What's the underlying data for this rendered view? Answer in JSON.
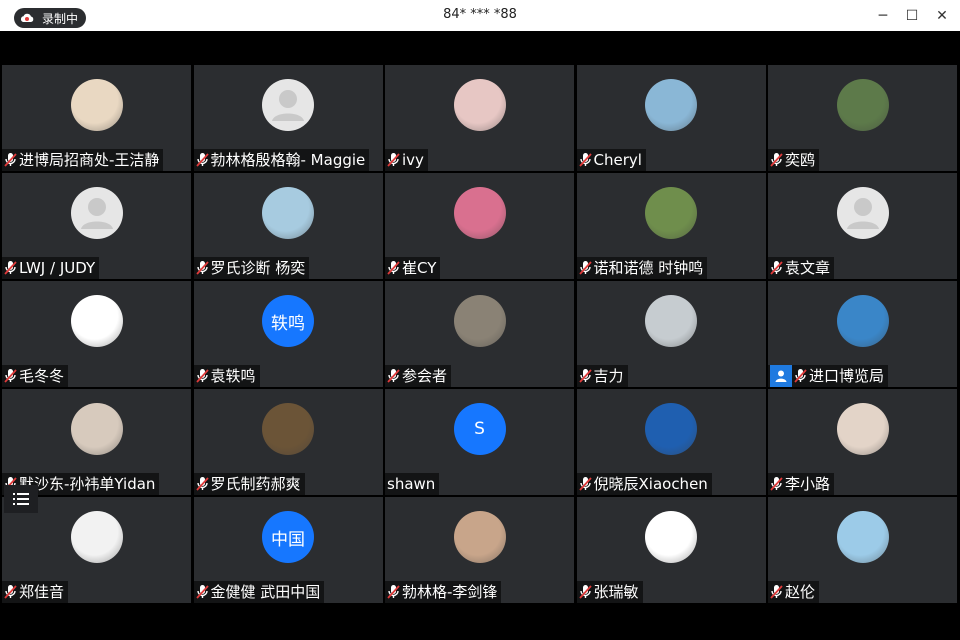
{
  "window": {
    "title": "84* *** *88",
    "minimize": "─",
    "maximize": "☐",
    "close": "✕"
  },
  "recording": {
    "label": "录制中"
  },
  "participants": [
    {
      "name": "进博局招商处-王洁静",
      "avatar": "photo",
      "color": "#e9d8c2"
    },
    {
      "name": "勃林格殷格翰- Maggie",
      "avatar": "default",
      "color": "#e6e6e6"
    },
    {
      "name": "ivy",
      "avatar": "photo",
      "color": "#e7c7c4"
    },
    {
      "name": "Cheryl",
      "avatar": "photo",
      "color": "#8ab7d6"
    },
    {
      "name": "奕鸥",
      "avatar": "photo",
      "color": "#5d7a4a"
    },
    {
      "name": "LWJ / JUDY",
      "avatar": "default",
      "color": "#e6e6e6"
    },
    {
      "name": "罗氏诊断 杨奕",
      "avatar": "photo",
      "color": "#a7cbe0"
    },
    {
      "name": "崔CY",
      "avatar": "photo",
      "color": "#d9708f"
    },
    {
      "name": "诺和诺德 时钟鸣",
      "avatar": "photo",
      "color": "#6f8e4c"
    },
    {
      "name": "袁文章",
      "avatar": "default",
      "color": "#e6e6e6"
    },
    {
      "name": "毛冬冬",
      "avatar": "photo",
      "color": "#ffffff"
    },
    {
      "name": "袁轶鸣",
      "avatar": "text",
      "initials": "轶鸣",
      "color": "#1677ff"
    },
    {
      "name": "参会者",
      "avatar": "photo",
      "color": "#8a8275"
    },
    {
      "name": "吉力",
      "avatar": "photo",
      "color": "#c6ccd0"
    },
    {
      "name": "进口博览局",
      "avatar": "photo",
      "color": "#3a86c8",
      "usericon": true
    },
    {
      "name": "默沙东-孙祎单Yidan",
      "avatar": "photo",
      "color": "#d7cabd"
    },
    {
      "name": "罗氏制药郝爽",
      "avatar": "photo",
      "color": "#6b5437"
    },
    {
      "name": "shawn",
      "avatar": "text",
      "initials": "S",
      "color": "#1677ff",
      "nomic": true
    },
    {
      "name": "倪晓辰Xiaochen",
      "avatar": "photo",
      "color": "#1f5fb0"
    },
    {
      "name": "李小路",
      "avatar": "photo",
      "color": "#e3d4c8"
    },
    {
      "name": "郑佳音",
      "avatar": "photo",
      "color": "#f2f2f2"
    },
    {
      "name": "金健健 武田中国",
      "avatar": "text",
      "initials": "中国",
      "color": "#1677ff"
    },
    {
      "name": "勃林格-李剑锋",
      "avatar": "photo",
      "color": "#c8a58a"
    },
    {
      "name": "张瑞敏",
      "avatar": "photo",
      "color": "#ffffff"
    },
    {
      "name": "赵伦",
      "avatar": "photo",
      "color": "#9ccbe8"
    }
  ]
}
